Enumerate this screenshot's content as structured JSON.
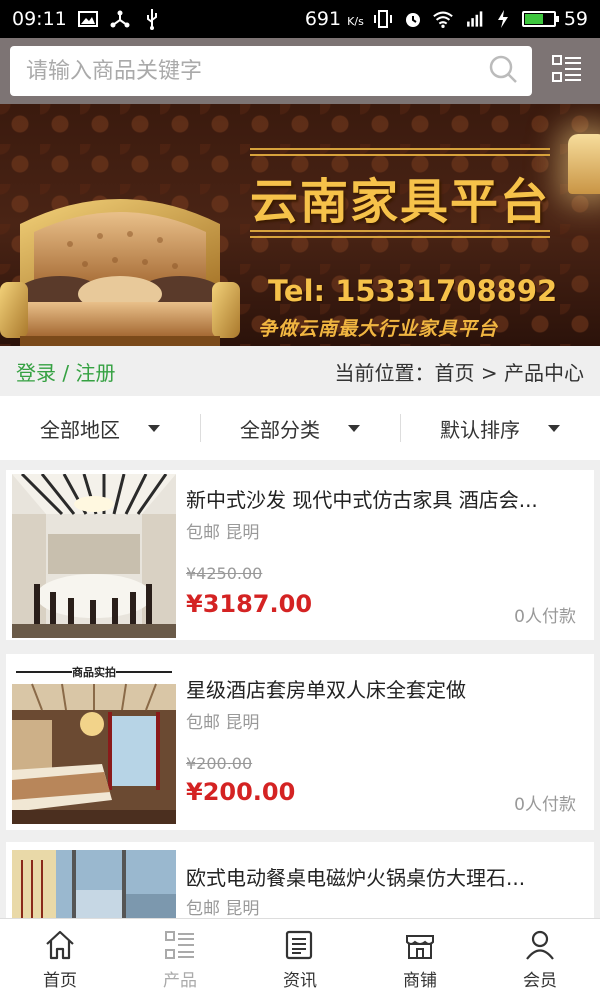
{
  "status_bar": {
    "time": "09:11",
    "net_speed": "691",
    "net_unit": "K/s",
    "battery": "59",
    "battery_level": 0.59
  },
  "search": {
    "placeholder": "请输入商品关键字"
  },
  "banner": {
    "title": "云南家具平台",
    "tel": "Tel: 15331708892",
    "slogan": "争做云南最大行业家具平台"
  },
  "breadcrumb": {
    "login": "登录",
    "sep": "/",
    "register": "注册",
    "location": "当前位置：首页 > 产品中心"
  },
  "filters": [
    "全部地区",
    "全部分类",
    "默认排序"
  ],
  "products": [
    {
      "title": "新中式沙发 现代中式仿古家具 酒店会...",
      "shipping": "包邮",
      "city": "昆明",
      "old_price": "¥4250.00",
      "price": "¥3187.00",
      "sold": "0人付款"
    },
    {
      "title": "星级酒店套房单双人床全套定做",
      "shipping": "包邮",
      "city": "昆明",
      "old_price": "¥200.00",
      "price": "¥200.00",
      "sold": "0人付款",
      "thumb_label": "商品实拍"
    },
    {
      "title": "欧式电动餐桌电磁炉火锅桌仿大理石...",
      "shipping": "包邮",
      "city": "昆明"
    }
  ],
  "tabs": [
    {
      "label": "首页",
      "icon": "home-icon"
    },
    {
      "label": "产品",
      "icon": "product-list-icon"
    },
    {
      "label": "资讯",
      "icon": "news-icon"
    },
    {
      "label": "商铺",
      "icon": "shop-icon"
    },
    {
      "label": "会员",
      "icon": "member-icon"
    }
  ],
  "colors": {
    "header_bg": "#7d7474",
    "login_green": "#35a142",
    "price_red": "#d42323",
    "banner_gold": "#f6c24a"
  }
}
